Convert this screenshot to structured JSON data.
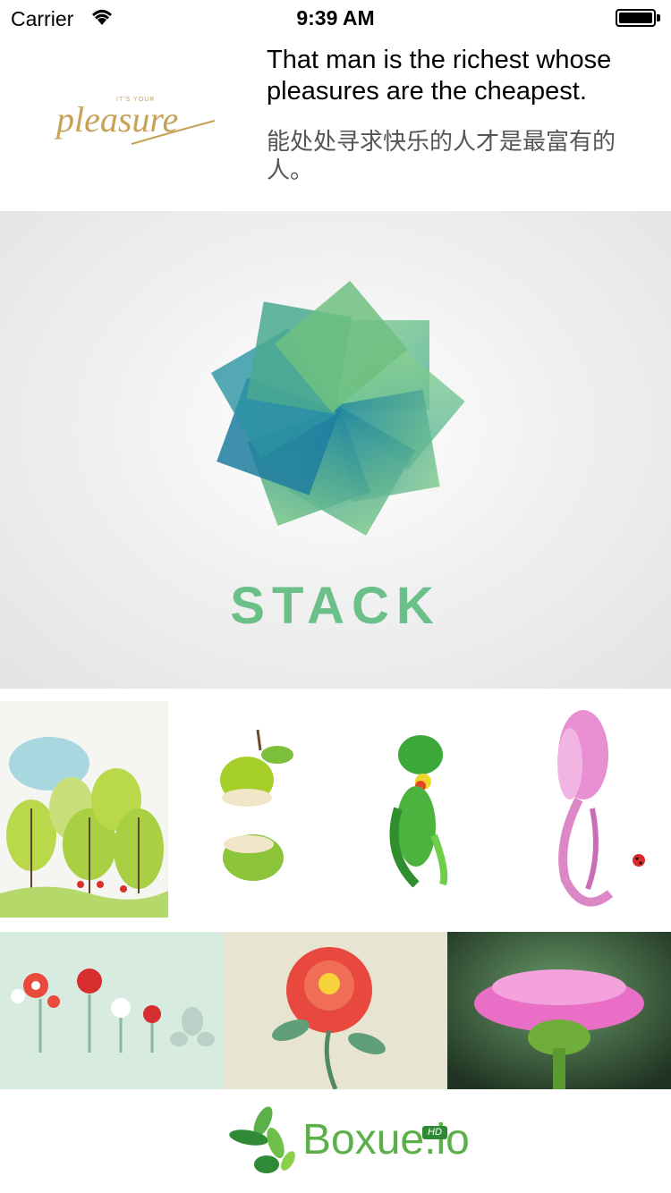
{
  "status_bar": {
    "carrier": "Carrier",
    "time": "9:39 AM"
  },
  "header": {
    "logo_icon": "pleasure-script-logo",
    "quote_en": "That man is the richest whose pleasures are the cheapest.",
    "quote_zh": "能处处寻求快乐的人才是最富有的人。"
  },
  "hero": {
    "brand": "STACK",
    "icon": "stack-flower-logo"
  },
  "gallery": {
    "row1": [
      "trees-illustration",
      "green-fruit-illustration",
      "green-parrot-illustration",
      "pink-tulip-ladybug-illustration"
    ],
    "row2": [
      "flower-pattern-illustration",
      "red-peony-illustration",
      "pink-flower-photo"
    ]
  },
  "footer": {
    "brand": "Boxue.io",
    "badge": "HD",
    "icon": "leaf-logo-icon"
  }
}
